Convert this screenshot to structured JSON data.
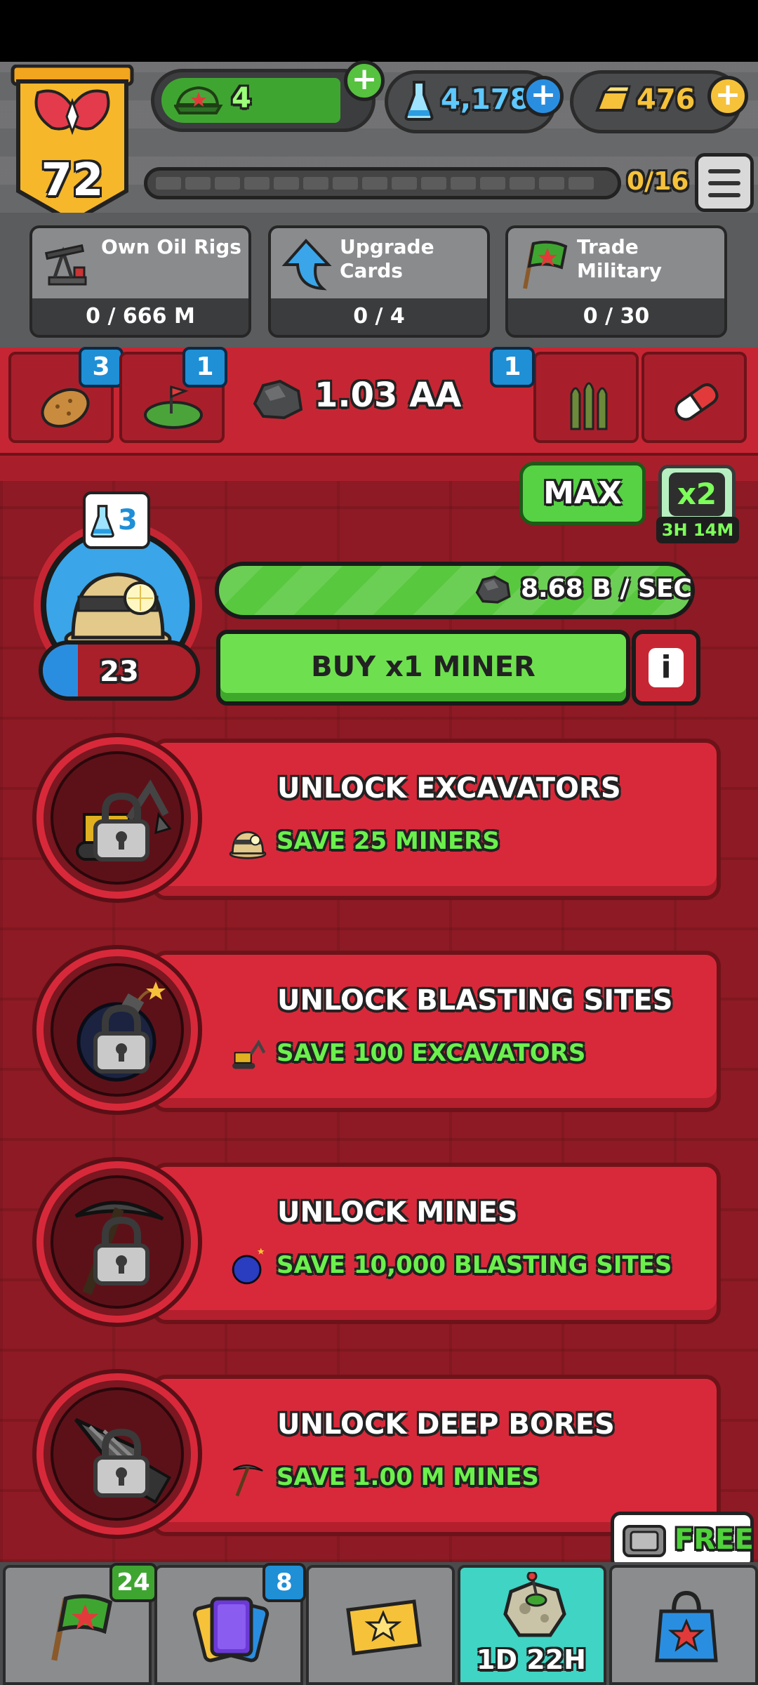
{
  "header": {
    "level": "72",
    "military_tokens": "4",
    "science": "4,178",
    "gold": "476",
    "progress_text": "0/16",
    "plus_label": "+"
  },
  "missions": [
    {
      "label_line1": "Own Oil Rigs",
      "label_line2": "",
      "count": "0 / 666 M",
      "icon": "oil-rig-icon"
    },
    {
      "label_line1": "Upgrade",
      "label_line2": "Cards",
      "count": "0 / 4",
      "icon": "up-arrow-icon"
    },
    {
      "label_line1": "Trade",
      "label_line2": "Military",
      "count": "0 / 30",
      "icon": "military-flag-icon"
    }
  ],
  "categories": {
    "tabs": [
      {
        "name": "potato",
        "badge": "3"
      },
      {
        "name": "land",
        "badge": "1"
      },
      {
        "name": "ammo",
        "badge": "1"
      },
      {
        "name": "medicine",
        "badge": ""
      }
    ],
    "current_resource": "1.03 AA"
  },
  "multiplier": {
    "max_label": "MAX",
    "x2_label": "x2",
    "x2_timer": "3H 14M"
  },
  "miner": {
    "flask_count": "3",
    "count": "23",
    "fill_fraction": 0.23,
    "rate": "8.68 B / SEC",
    "buy_label": "BUY x1 MINER",
    "info_label": "i"
  },
  "unlocks": [
    {
      "title": "UNLOCK EXCAVATORS",
      "req": "SAVE 25 MINERS",
      "icon": "excavator-icon",
      "req_icon": "miner-helmet-icon"
    },
    {
      "title": "UNLOCK BLASTING SITES",
      "req": "SAVE 100 EXCAVATORS",
      "icon": "bomb-icon",
      "req_icon": "excavator-icon"
    },
    {
      "title": "UNLOCK MINES",
      "req": "SAVE 10,000 BLASTING SITES",
      "icon": "pickaxe-icon",
      "req_icon": "bomb-icon"
    },
    {
      "title": "UNLOCK DEEP BORES",
      "req": "SAVE 1.00 M MINES",
      "icon": "drill-icon",
      "req_icon": "pickaxe-icon"
    }
  ],
  "free_label": "FREE",
  "bottom_nav": {
    "tabs": [
      {
        "name": "military",
        "badge": "24"
      },
      {
        "name": "cards",
        "badge": "8"
      },
      {
        "name": "ticket",
        "badge": ""
      },
      {
        "name": "event",
        "badge": ""
      },
      {
        "name": "shop",
        "badge": ""
      }
    ],
    "event_timer": "1D 22H"
  },
  "colors": {
    "primary_red": "#c62633",
    "green": "#6ee04f",
    "blue": "#1f8fd6",
    "gold": "#f6c23a"
  }
}
